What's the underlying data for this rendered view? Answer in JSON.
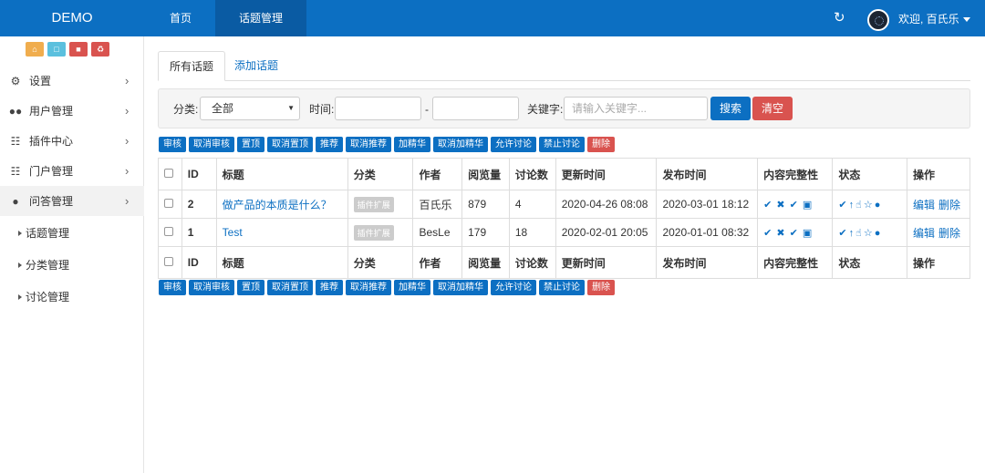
{
  "header": {
    "brand": "DEMO",
    "nav": [
      {
        "label": "首页"
      },
      {
        "label": "话题管理"
      }
    ],
    "welcome": "欢迎, 百氏乐"
  },
  "sidebar": {
    "quick_icons": [
      "home-icon",
      "file-icon",
      "trash-icon",
      "recycle-icon"
    ],
    "items": [
      {
        "label": "设置",
        "icon": "gears-icon"
      },
      {
        "label": "用户管理",
        "icon": "users-icon"
      },
      {
        "label": "插件中心",
        "icon": "sitemap-icon"
      },
      {
        "label": "门户管理",
        "icon": "grid-icon"
      },
      {
        "label": "问答管理",
        "icon": "wechat-icon"
      }
    ],
    "subitems": [
      {
        "label": "话题管理"
      },
      {
        "label": "分类管理"
      },
      {
        "label": "讨论管理"
      }
    ]
  },
  "tabs": [
    {
      "label": "所有话题"
    },
    {
      "label": "添加话题"
    }
  ],
  "filter": {
    "category_label": "分类:",
    "category_value": "全部",
    "time_label": "时间:",
    "dash": "-",
    "keyword_label": "关键字:",
    "keyword_placeholder": "请输入关键字...",
    "search": "搜索",
    "clear": "清空"
  },
  "actions": [
    "审核",
    "取消审核",
    "置顶",
    "取消置顶",
    "推荐",
    "取消推荐",
    "加精华",
    "取消加精华",
    "允许讨论",
    "禁止讨论",
    "删除"
  ],
  "table": {
    "headers": [
      "ID",
      "标题",
      "分类",
      "作者",
      "阅览量",
      "讨论数",
      "更新时间",
      "发布时间",
      "内容完整性",
      "状态",
      "操作"
    ],
    "rows": [
      {
        "id": "2",
        "title": "做产品的本质是什么？",
        "category": "插件扩展",
        "author": "百氏乐",
        "views": "879",
        "comments": "4",
        "updated": "2020-04-26 08:08",
        "published": "2020-03-01 18:12",
        "edit": "编辑",
        "delete": "删除"
      },
      {
        "id": "1",
        "title": "Test",
        "category": "插件扩展",
        "author": "BesLe",
        "views": "179",
        "comments": "18",
        "updated": "2020-02-01 20:05",
        "published": "2020-01-01 08:32",
        "edit": "编辑",
        "delete": "删除"
      }
    ]
  },
  "colors": {
    "primary": "#0c6fc2",
    "danger": "#d9534f"
  }
}
